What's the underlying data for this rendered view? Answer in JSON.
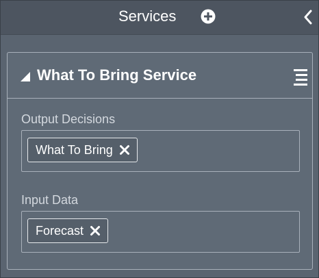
{
  "header": {
    "title": "Services",
    "add_icon": "plus-circle-icon",
    "collapse_icon": "chevron-left-icon"
  },
  "card": {
    "title": "What To Bring Service",
    "expand_icon": "triangle-expand-icon",
    "menu_icon": "hamburger-menu-icon",
    "sections": [
      {
        "label": "Output Decisions",
        "chips": [
          {
            "label": "What To Bring",
            "remove_icon": "close-icon"
          }
        ]
      },
      {
        "label": "Input Data",
        "chips": [
          {
            "label": "Forecast",
            "remove_icon": "close-icon"
          }
        ]
      }
    ]
  },
  "colors": {
    "panel_bg": "#5a6470",
    "header_bg": "#4d5560",
    "card_bg": "#5f6a76",
    "border": "#a9b1bb",
    "text": "#ffffff",
    "muted_text": "#d3d8de"
  }
}
